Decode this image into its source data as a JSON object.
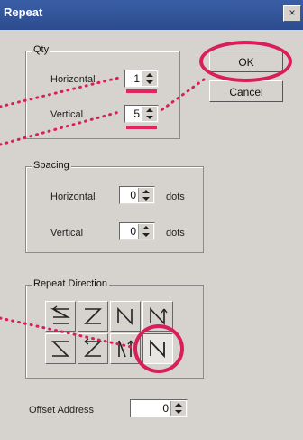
{
  "window": {
    "title": "Repeat",
    "close_glyph": "×"
  },
  "qty": {
    "label": "Qty",
    "horizontal_label": "Horizontal",
    "horizontal_value": "1",
    "vertical_label": "Vertical",
    "vertical_value": "5"
  },
  "spacing": {
    "label": "Spacing",
    "horizontal_label": "Horizontal",
    "horizontal_value": "0",
    "vertical_label": "Vertical",
    "vertical_value": "0",
    "unit": "dots"
  },
  "buttons": {
    "ok": "OK",
    "cancel": "Cancel"
  },
  "repeat_direction": {
    "label": "Repeat Direction",
    "selected_index": 7,
    "options": [
      {
        "icon": "zigzag-left-icon"
      },
      {
        "icon": "z-down-icon"
      },
      {
        "icon": "n-up-icon"
      },
      {
        "icon": "n-down-icon"
      },
      {
        "icon": "s-up-icon"
      },
      {
        "icon": "z-diagonal-icon"
      },
      {
        "icon": "zigzag-vertical-icon"
      },
      {
        "icon": "n-selected-icon"
      }
    ]
  },
  "offset": {
    "label": "Offset Address",
    "value": "0"
  },
  "annotation": {
    "color": "#d81f5c"
  }
}
